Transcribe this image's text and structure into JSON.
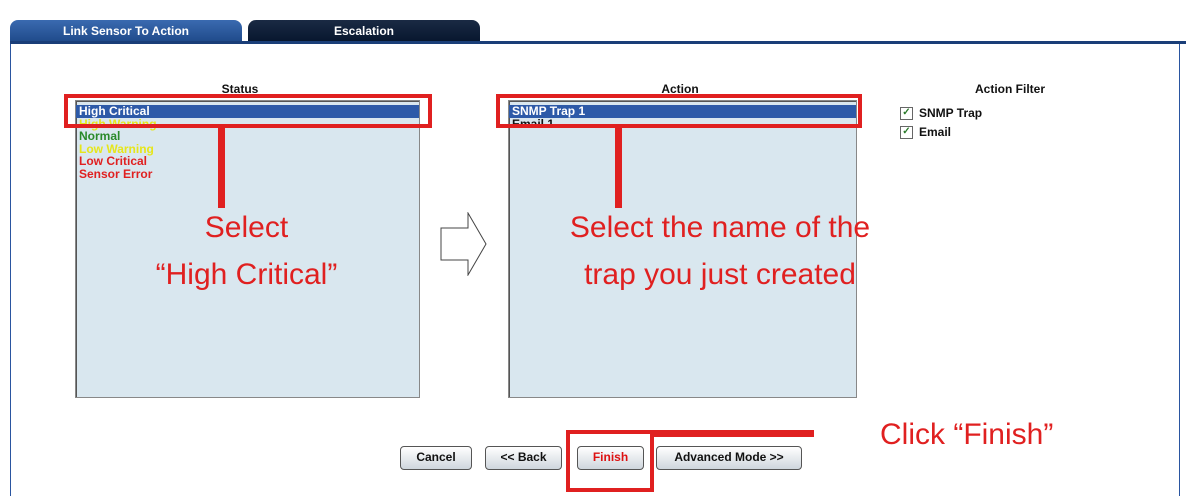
{
  "tabs": [
    {
      "label": "Link Sensor To Action",
      "active": true
    },
    {
      "label": "Escalation",
      "active": false
    }
  ],
  "status": {
    "title": "Status",
    "items": [
      {
        "label": "High Critical",
        "color": "#ffffff",
        "selected": true
      },
      {
        "label": "High Warning",
        "color": "#e6e61a",
        "selected": false
      },
      {
        "label": "Normal",
        "color": "#2a8a2a",
        "selected": false
      },
      {
        "label": "Low Warning",
        "color": "#e6e61a",
        "selected": false
      },
      {
        "label": "Low Critical",
        "color": "#e02020",
        "selected": false
      },
      {
        "label": "Sensor Error",
        "color": "#e02020",
        "selected": false
      }
    ]
  },
  "action": {
    "title": "Action",
    "items": [
      {
        "label": "SNMP Trap 1",
        "selected": true
      },
      {
        "label": "Email 1",
        "selected": false
      }
    ]
  },
  "action_filter": {
    "title": "Action Filter",
    "options": [
      {
        "label": "SNMP Trap",
        "checked": true
      },
      {
        "label": "Email",
        "checked": true
      }
    ]
  },
  "buttons": {
    "cancel": "Cancel",
    "back": "<< Back",
    "finish": "Finish",
    "advanced": "Advanced Mode >>"
  },
  "annotations": {
    "select_status_line1": "Select",
    "select_status_line2": "“High Critical”",
    "select_action_line1": "Select the name of the",
    "select_action_line2": "trap you just created",
    "click_finish": "Click “Finish”"
  },
  "colors": {
    "accent": "#2d5aa8",
    "annotation": "#e02020",
    "listbox_bg": "#d9e7ef"
  }
}
